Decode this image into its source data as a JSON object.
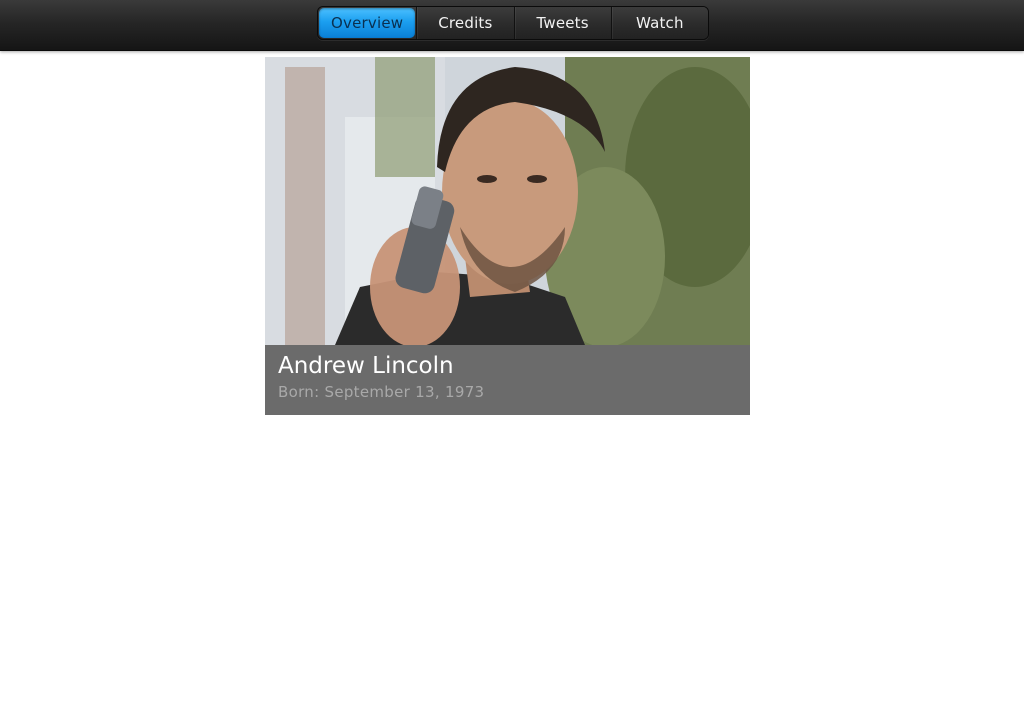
{
  "nav": {
    "tabs": [
      {
        "label": "Overview",
        "active": true
      },
      {
        "label": "Credits",
        "active": false
      },
      {
        "label": "Tweets",
        "active": false
      },
      {
        "label": "Watch",
        "active": false
      }
    ],
    "accent_color": "#1b9ff0"
  },
  "profile": {
    "name": "Andrew Lincoln",
    "born": "Born: September 13, 1973",
    "photo_icon": "person-photo"
  }
}
